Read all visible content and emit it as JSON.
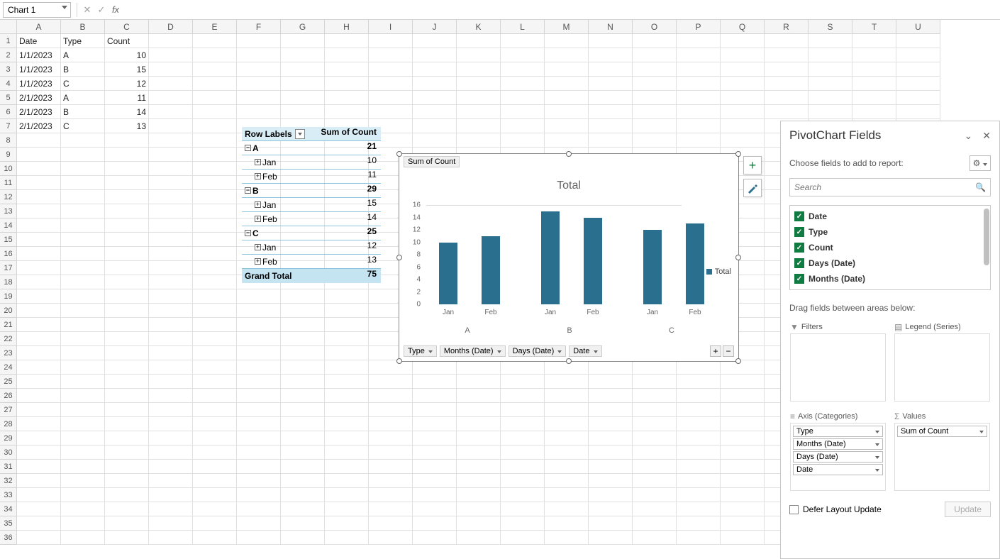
{
  "namebox": "Chart 1",
  "columns": [
    "A",
    "B",
    "C",
    "D",
    "E",
    "F",
    "G",
    "H",
    "I",
    "J",
    "K",
    "L",
    "M",
    "N",
    "O",
    "P",
    "Q",
    "R",
    "S",
    "T",
    "U"
  ],
  "sheet": {
    "headers": [
      "Date",
      "Type",
      "Count"
    ],
    "rows": [
      [
        "1/1/2023",
        "A",
        "10"
      ],
      [
        "1/1/2023",
        "B",
        "15"
      ],
      [
        "1/1/2023",
        "C",
        "12"
      ],
      [
        "2/1/2023",
        "A",
        "11"
      ],
      [
        "2/1/2023",
        "B",
        "14"
      ],
      [
        "2/1/2023",
        "C",
        "13"
      ]
    ]
  },
  "pivot": {
    "h1": "Row Labels",
    "h2": "Sum of Count",
    "items": [
      {
        "label": "A",
        "val": "21",
        "lvl": 0,
        "exp": "−",
        "bold": true
      },
      {
        "label": "Jan",
        "val": "10",
        "lvl": 1,
        "exp": "+"
      },
      {
        "label": "Feb",
        "val": "11",
        "lvl": 1,
        "exp": "+"
      },
      {
        "label": "B",
        "val": "29",
        "lvl": 0,
        "exp": "−",
        "bold": true
      },
      {
        "label": "Jan",
        "val": "15",
        "lvl": 1,
        "exp": "+"
      },
      {
        "label": "Feb",
        "val": "14",
        "lvl": 1,
        "exp": "+"
      },
      {
        "label": "C",
        "val": "25",
        "lvl": 0,
        "exp": "−",
        "bold": true
      },
      {
        "label": "Jan",
        "val": "12",
        "lvl": 1,
        "exp": "+"
      },
      {
        "label": "Feb",
        "val": "13",
        "lvl": 1,
        "exp": "+"
      }
    ],
    "gt_label": "Grand Total",
    "gt_val": "75"
  },
  "chart_data": {
    "type": "bar",
    "title": "Total",
    "badge": "Sum of Count",
    "ylabel": "",
    "ylim": [
      0,
      16
    ],
    "yticks": [
      0,
      2,
      4,
      6,
      8,
      10,
      12,
      14,
      16
    ],
    "groups": [
      "A",
      "B",
      "C"
    ],
    "categories": [
      "Jan",
      "Feb",
      "Jan",
      "Feb",
      "Jan",
      "Feb"
    ],
    "series": [
      {
        "name": "Total",
        "values": [
          10,
          11,
          15,
          14,
          12,
          13
        ]
      }
    ],
    "filters": [
      "Type",
      "Months (Date)",
      "Days (Date)",
      "Date"
    ]
  },
  "pane": {
    "title": "PivotChart Fields",
    "sub": "Choose fields to add to report:",
    "search_placeholder": "Search",
    "fields": [
      "Date",
      "Type",
      "Count",
      "Days (Date)",
      "Months (Date)"
    ],
    "drag": "Drag fields between areas below:",
    "zone_filters": "Filters",
    "zone_legend": "Legend (Series)",
    "zone_axis": "Axis (Categories)",
    "zone_values": "Values",
    "axis_items": [
      "Type",
      "Months (Date)",
      "Days (Date)",
      "Date"
    ],
    "values_items": [
      "Sum of Count"
    ],
    "defer": "Defer Layout Update",
    "update": "Update"
  }
}
